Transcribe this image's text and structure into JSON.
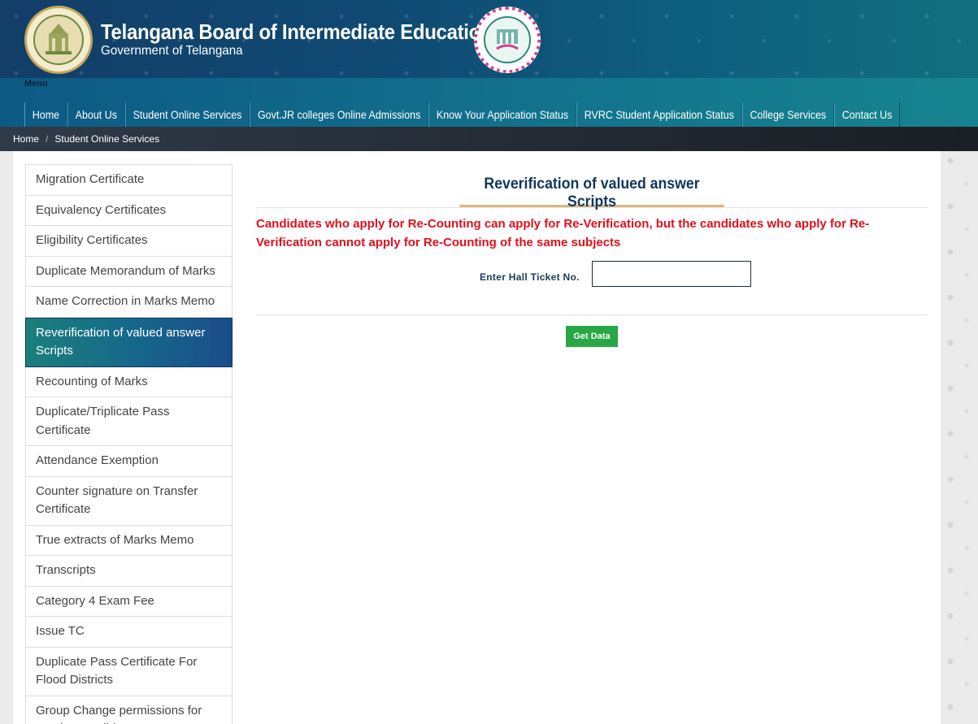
{
  "header": {
    "title": "Telangana Board of Intermediate Education",
    "subtitle": "Government of Telangana"
  },
  "nav": {
    "menu_label": "Menu",
    "items": [
      "Home",
      "About Us",
      "Student Online Services",
      "Govt.JR colleges Online Admissions",
      "Know Your Application Status",
      "RVRC Student Application Status",
      "College Services",
      "Contact Us"
    ]
  },
  "breadcrumb": {
    "home": "Home",
    "separator": "/",
    "current": "Student Online Services"
  },
  "sidebar": {
    "items": [
      "Migration Certificate",
      "Equivalency Certificates",
      "Eligibility Certificates",
      "Duplicate Memorandum of Marks",
      "Name Correction in Marks Memo",
      "Reverification of valued answer Scripts",
      "Recounting of Marks",
      "Duplicate/Triplicate Pass Certificate",
      "Attendance Exemption",
      "Counter signature on Transfer Certificate",
      "True extracts of Marks Memo",
      "Transcripts",
      "Category 4 Exam Fee",
      "Issue TC",
      "Duplicate Pass Certificate For Flood Districts",
      "Group Change permissions for regular Candidates"
    ],
    "active_index": 5
  },
  "main": {
    "title": "Reverification of valued answer Scripts",
    "notice": "Candidates who apply for Re-Counting can apply for Re-Verification, but the candidates who apply for Re-Verification cannot apply for Re-Counting of the same subjects",
    "hall_ticket_label": "Enter Hall Ticket No.",
    "hall_ticket_value": "",
    "hall_ticket_placeholder": "",
    "submit_label": "Get Data"
  },
  "colors": {
    "header_bg": "#123e68",
    "nav_bg": "#13748d",
    "active_item": "#16698a",
    "notice_text": "#e0101c",
    "title_text": "#12365e",
    "title_underline": "#d9b97f",
    "button_green": "#28a745"
  },
  "icons": {
    "state_emblem": "government-emblem-icon",
    "board_logo": "board-seal-icon"
  }
}
